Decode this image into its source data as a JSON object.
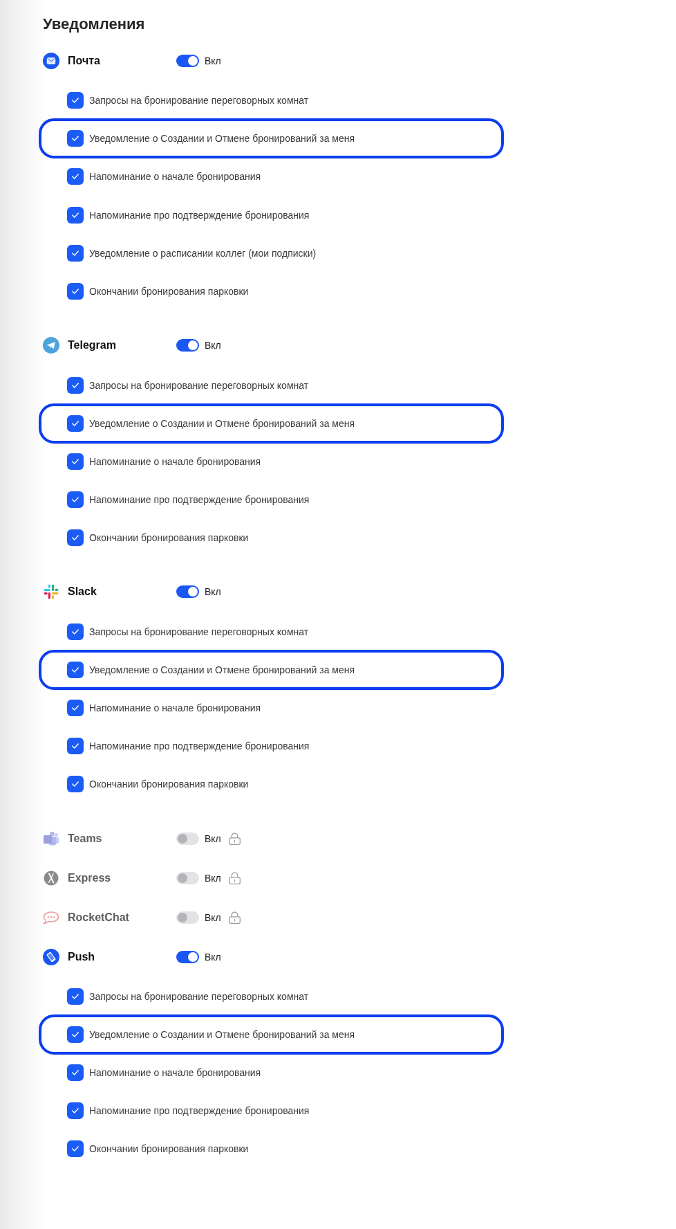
{
  "title": "Уведомления",
  "channels": [
    {
      "name": "Почта",
      "kind": "mail",
      "on": true,
      "locked": false,
      "toggle_label": "Вкл",
      "options": [
        {
          "label": "Запросы на бронирование переговорных комнат",
          "checked": true,
          "highlighted": false
        },
        {
          "label": "Уведомление о Создании и Отмене бронирований за меня",
          "checked": true,
          "highlighted": true
        },
        {
          "label": "Напоминание о начале бронирования",
          "checked": true,
          "highlighted": false
        },
        {
          "label": "Напоминание про подтверждение бронирования",
          "checked": true,
          "highlighted": false
        },
        {
          "label": "Уведомление о расписании коллег (мои подписки)",
          "checked": true,
          "highlighted": false
        },
        {
          "label": "Окончании бронирования парковки",
          "checked": true,
          "highlighted": false
        }
      ]
    },
    {
      "name": "Telegram",
      "kind": "plane",
      "on": true,
      "locked": false,
      "toggle_label": "Вкл",
      "options": [
        {
          "label": "Запросы на бронирование переговорных комнат",
          "checked": true,
          "highlighted": false
        },
        {
          "label": "Уведомление о Создании и Отмене бронирований за меня",
          "checked": true,
          "highlighted": true
        },
        {
          "label": "Напоминание о начале бронирования",
          "checked": true,
          "highlighted": false
        },
        {
          "label": "Напоминание про подтверждение бронирования",
          "checked": true,
          "highlighted": false
        },
        {
          "label": "Окончании бронирования парковки",
          "checked": true,
          "highlighted": false
        }
      ]
    },
    {
      "name": "Slack",
      "kind": "pinwheel",
      "on": true,
      "locked": false,
      "toggle_label": "Вкл",
      "options": [
        {
          "label": "Запросы на бронирование переговорных комнат",
          "checked": true,
          "highlighted": false
        },
        {
          "label": "Уведомление о Создании и Отмене бронирований за меня",
          "checked": true,
          "highlighted": true
        },
        {
          "label": "Напоминание о начале бронирования",
          "checked": true,
          "highlighted": false
        },
        {
          "label": "Напоминание про подтверждение бронирования",
          "checked": true,
          "highlighted": false
        },
        {
          "label": "Окончании бронирования парковки",
          "checked": true,
          "highlighted": false
        }
      ]
    },
    {
      "name": "Teams",
      "kind": "people",
      "on": false,
      "locked": true,
      "toggle_label": "Вкл"
    },
    {
      "name": "Express",
      "kind": "cross",
      "on": false,
      "locked": true,
      "toggle_label": "Вкл"
    },
    {
      "name": "RocketChat",
      "kind": "bubble",
      "on": false,
      "locked": true,
      "toggle_label": "Вкл"
    },
    {
      "name": "Push",
      "kind": "phone",
      "on": true,
      "locked": false,
      "toggle_label": "Вкл",
      "options": [
        {
          "label": "Запросы на бронирование переговорных комнат",
          "checked": true,
          "highlighted": false
        },
        {
          "label": "Уведомление о Создании и Отмене бронирований за меня",
          "checked": true,
          "highlighted": true
        },
        {
          "label": "Напоминание о начале бронирования",
          "checked": true,
          "highlighted": false
        },
        {
          "label": "Напоминание про подтверждение бронирования",
          "checked": true,
          "highlighted": false
        },
        {
          "label": "Окончании бронирования парковки",
          "checked": true,
          "highlighted": false
        }
      ]
    }
  ]
}
